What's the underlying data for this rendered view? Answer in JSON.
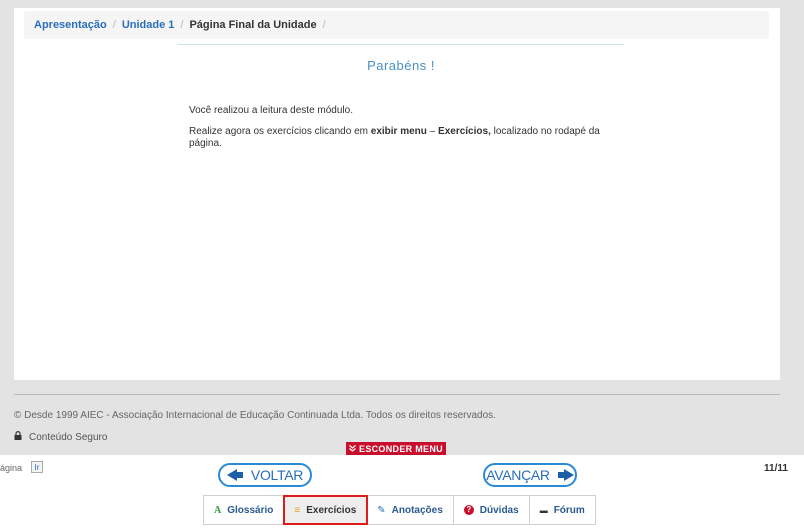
{
  "breadcrumb": {
    "items": [
      "Apresentação",
      "Unidade 1",
      "Página Final da Unidade"
    ]
  },
  "page": {
    "heading": "Parabéns !",
    "line1": "Você realizou a leitura deste módulo.",
    "line2_prefix": "Realize agora os exercícios clicando em ",
    "line2_bold1": "exibir menu",
    "line2_mid": " – ",
    "line2_bold2": "Exercícios,",
    "line2_suffix": " localizado no rodapé da página."
  },
  "footer": {
    "copyright": "© Desde 1999 AIEC - Associação Internacional de Educação Continuada Ltda. Todos os direitos reservados.",
    "secure": "Conteúdo Seguro",
    "hide_menu": "ESCONDER MENU"
  },
  "nav": {
    "page_label": "ágina",
    "go_label": "Ir",
    "back": "VOLTAR",
    "forward": "AVANÇAR",
    "page_count": "11/11"
  },
  "menu": {
    "items": [
      {
        "label": "Glossário",
        "icon": "A"
      },
      {
        "label": "Exercícios",
        "icon": "≡"
      },
      {
        "label": "Anotações",
        "icon": "✎"
      },
      {
        "label": "Dúvidas",
        "icon": "?"
      },
      {
        "label": "Fórum",
        "icon": "▬"
      }
    ]
  },
  "colors": {
    "accent": "#2a6ebb",
    "hide_menu_bg": "#c8102e",
    "active_outline": "#e01b1b"
  }
}
